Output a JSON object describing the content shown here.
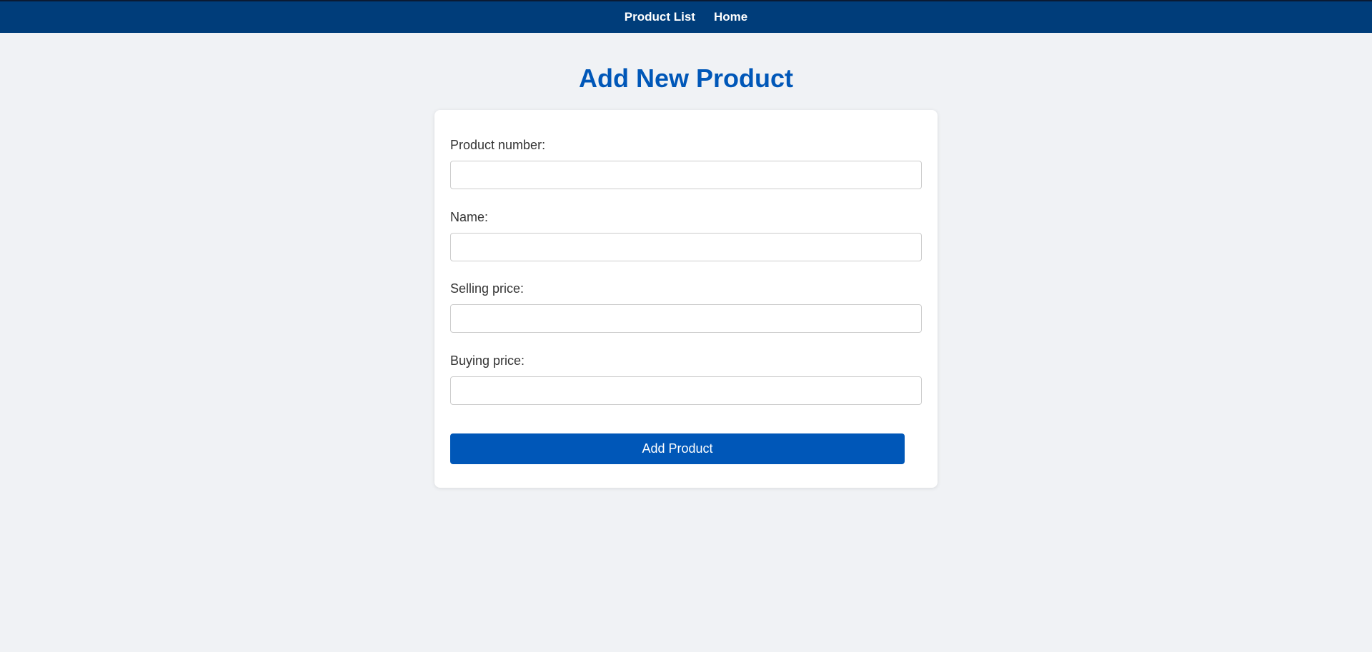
{
  "nav": {
    "product_list": "Product List",
    "home": "Home"
  },
  "page": {
    "title": "Add New Product"
  },
  "form": {
    "fields": [
      {
        "label": "Product number:",
        "value": "",
        "placeholder": ""
      },
      {
        "label": "Name:",
        "value": "",
        "placeholder": ""
      },
      {
        "label": "Selling price:",
        "value": "",
        "placeholder": ""
      },
      {
        "label": "Buying price:",
        "value": "",
        "placeholder": ""
      }
    ],
    "submit_label": "Add Product"
  },
  "colors": {
    "navbar": "#003d7a",
    "accent": "#0057b8",
    "background": "#f0f2f5"
  }
}
